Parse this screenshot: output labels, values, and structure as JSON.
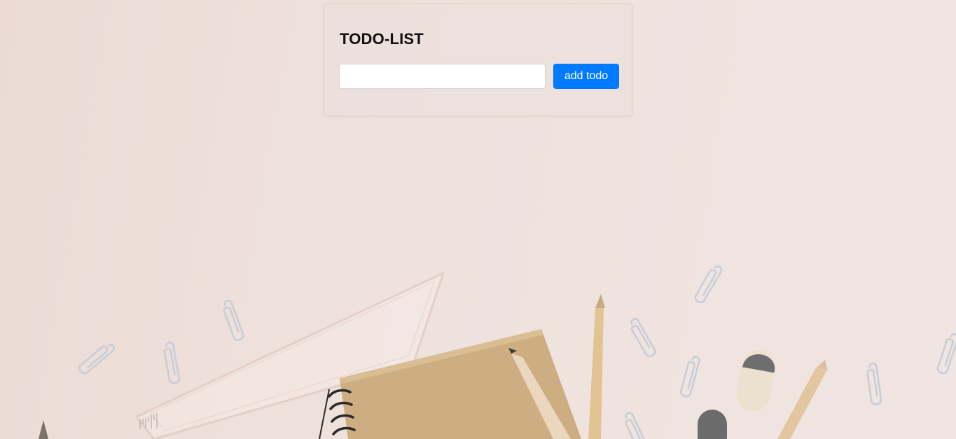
{
  "app": {
    "title": "TODO-LIST"
  },
  "todo_form": {
    "input_value": "",
    "input_placeholder": "",
    "add_button_label": "add todo"
  },
  "colors": {
    "accent": "#007bff",
    "background": "#efe2dd"
  },
  "background_image": {
    "icons": [
      "paperclip-icon",
      "ruler-icon",
      "notebook-icon",
      "pencil-icon",
      "eraser-icon"
    ]
  }
}
